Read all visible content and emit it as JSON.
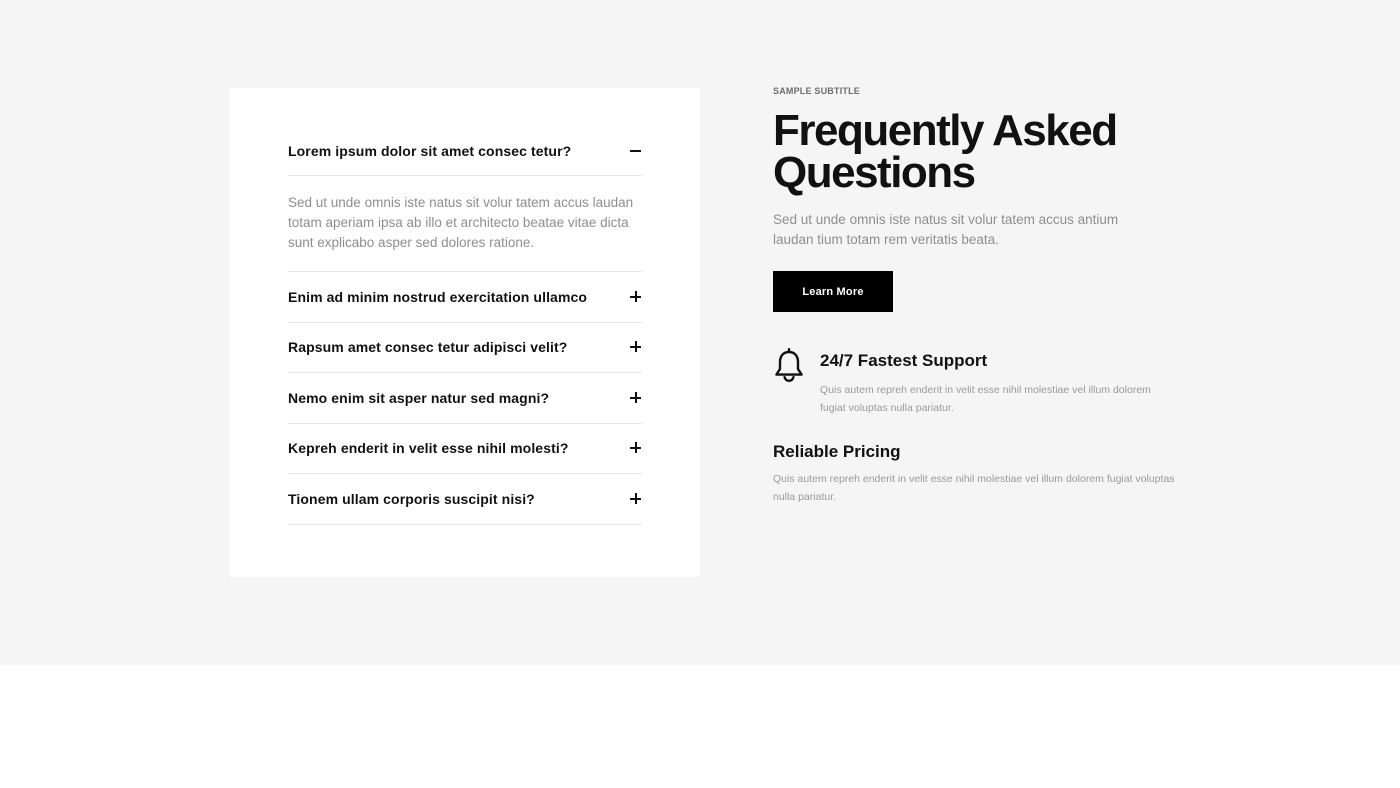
{
  "faq": {
    "items": [
      {
        "question": "Lorem ipsum dolor sit amet consec tetur?",
        "answer": "Sed ut unde omnis iste natus sit volur tatem accus laudan totam aperiam ipsa ab illo et architecto beatae vitae dicta sunt explicabo asper sed dolores ratione.",
        "open": true,
        "toggle_icon": "minus-icon"
      },
      {
        "question": "Enim ad minim nostrud exercitation ullamco",
        "open": false,
        "toggle_icon": "plus-icon"
      },
      {
        "question": "Rapsum amet consec tetur adipisci velit?",
        "open": false,
        "toggle_icon": "plus-icon"
      },
      {
        "question": "Nemo enim sit asper natur sed magni?",
        "open": false,
        "toggle_icon": "plus-icon"
      },
      {
        "question": "Kepreh enderit in velit esse nihil molesti?",
        "open": false,
        "toggle_icon": "plus-icon"
      },
      {
        "question": "Tionem ullam corporis suscipit nisi?",
        "open": false,
        "toggle_icon": "plus-icon"
      }
    ]
  },
  "intro": {
    "subtitle": "SAMPLE SUBTITLE",
    "heading": "Frequently Asked Questions",
    "lead": "Sed ut unde omnis iste natus sit volur tatem accus antium laudan tium totam rem veritatis beata.",
    "button_label": "Learn More"
  },
  "features": {
    "support": {
      "icon": "bell-icon",
      "title": "24/7 Fastest Support",
      "text": "Quis autem repreh enderit in velit esse nihil molestiae vel illum dolorem fugiat voluptas nulla pariatur."
    },
    "pricing": {
      "title": "Reliable Pricing",
      "text": "Quis autem repreh enderit in velit esse nihil molestiae vel illum dolorem fugiat voluptas nulla pariatur."
    }
  },
  "colors": {
    "section_background": "#f5f5f5",
    "card_background": "#ffffff",
    "button_background": "#000000",
    "muted_text": "#8e8e8e"
  }
}
